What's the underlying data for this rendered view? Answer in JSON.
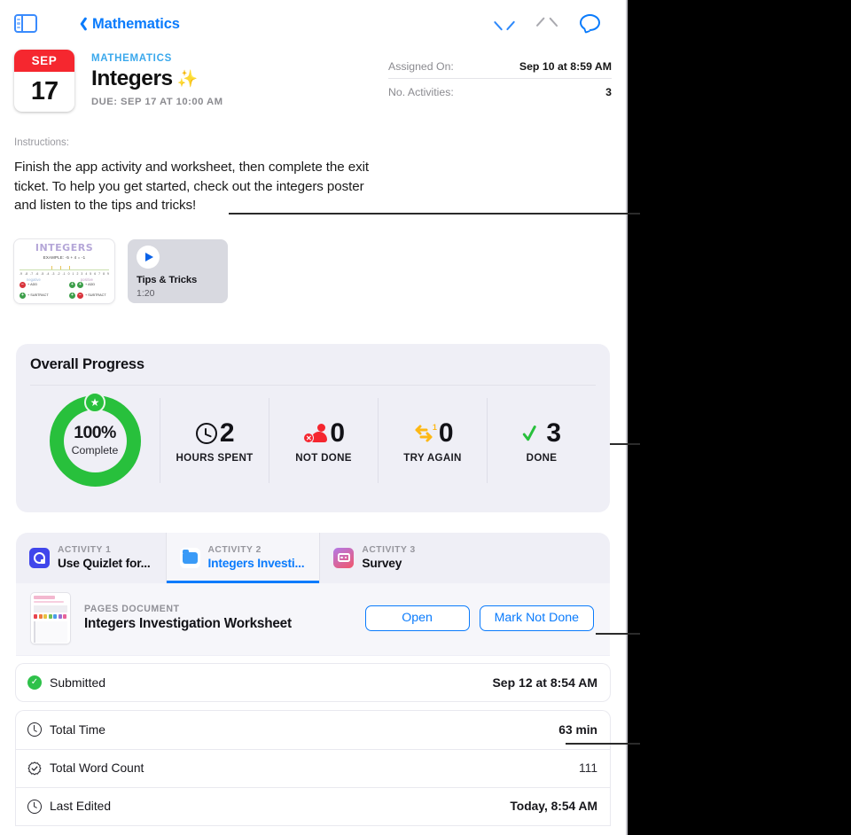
{
  "nav": {
    "sidebar_toggle_icon": "sidebar-toggle-icon",
    "back_label": "Mathematics",
    "back_icon": "chevron-left-icon",
    "prev_icon": "chevron-up-icon",
    "next_icon": "chevron-down-icon",
    "comment_icon": "comment-bubble-icon"
  },
  "header": {
    "calendar_month": "SEP",
    "calendar_day": "17",
    "calendar_accent": "#f5272f",
    "course": "MATHEMATICS",
    "title": "Integers",
    "title_emoji": "✨",
    "due": "DUE: SEP 17 AT 10:00 AM",
    "meta": [
      {
        "key": "Assigned On:",
        "value": "Sep 10 at 8:59 AM"
      },
      {
        "key": "No. Activities:",
        "value": "3"
      }
    ]
  },
  "instructions": {
    "label": "Instructions:",
    "body": "Finish the app activity and worksheet, then complete the exit ticket. To help you get started, check out the integers poster and listen to the tips and tricks!"
  },
  "attachments": {
    "poster": {
      "name": "integers-poster-thumbnail",
      "heading": "INTEGERS",
      "example": "EXAMPLE: -5 + 4 = -1",
      "left_label": "negative",
      "right_label": "positive",
      "rows": [
        {
          "left_sign": "−",
          "left_text": "+ ADD",
          "right_sign_a": "+",
          "right_sign_b": "+",
          "right_text": "+ ADD"
        },
        {
          "left_sign": "+",
          "left_text": "+ SUBTRACT",
          "right_sign_a": "+",
          "right_sign_b": "−",
          "right_text": "+ SUBTRACT"
        }
      ],
      "number_line": [
        "-9",
        "-8",
        "-7",
        "-6",
        "-5",
        "-4",
        "-3",
        "-2",
        "-1",
        "0",
        "1",
        "2",
        "3",
        "4",
        "5",
        "6",
        "7",
        "8",
        "9"
      ]
    },
    "video": {
      "name": "tips-and-tricks-video",
      "play_icon": "play-icon",
      "title": "Tips & Tricks",
      "duration": "1:20"
    }
  },
  "progress": {
    "title": "Overall Progress",
    "ring": {
      "percent": "100%",
      "percent_value": 100,
      "caption": "Complete",
      "color": "#28c03c",
      "badge_icon": "star-icon"
    },
    "stats": [
      {
        "icon": "clock-icon",
        "value": "2",
        "label": "HOURS SPENT",
        "color": "#121217"
      },
      {
        "icon": "not-done-icon",
        "value": "0",
        "label": "NOT DONE",
        "color": "#f5262f"
      },
      {
        "icon": "try-again-icon",
        "value": "0",
        "label": "TRY AGAIN",
        "color": "#fdb814"
      },
      {
        "icon": "check-icon",
        "value": "3",
        "label": "DONE",
        "color": "#28c03c"
      }
    ]
  },
  "activities": {
    "tabs": [
      {
        "kicker": "ACTIVITY 1",
        "name": "Use Quizlet for...",
        "icon": "quizlet-app-icon",
        "active": false
      },
      {
        "kicker": "ACTIVITY 2",
        "name": "Integers Investi...",
        "icon": "folder-icon",
        "active": true
      },
      {
        "kicker": "ACTIVITY 3",
        "name": "Survey",
        "icon": "survey-app-icon",
        "active": false
      }
    ],
    "document": {
      "thumb_name": "pages-document-thumbnail",
      "kicker": "PAGES DOCUMENT",
      "title": "Integers Investigation Worksheet",
      "open_label": "Open",
      "mark_label": "Mark Not Done"
    },
    "submitted": {
      "icon": "check-badge-icon",
      "label": "Submitted",
      "value": "Sep 12 at 8:54 AM"
    },
    "info_rows": [
      {
        "icon": "clock-icon",
        "label": "Total Time",
        "value": "63 min"
      },
      {
        "icon": "seal-check-icon",
        "label": "Total Word Count",
        "value": "111"
      },
      {
        "icon": "clock-icon",
        "label": "Last Edited",
        "value": "Today, 8:54 AM"
      }
    ]
  },
  "callouts": [
    {
      "name": "callout-line-attachments"
    },
    {
      "name": "callout-line-progress"
    },
    {
      "name": "callout-line-mark-not-done"
    },
    {
      "name": "callout-line-total-time"
    }
  ]
}
